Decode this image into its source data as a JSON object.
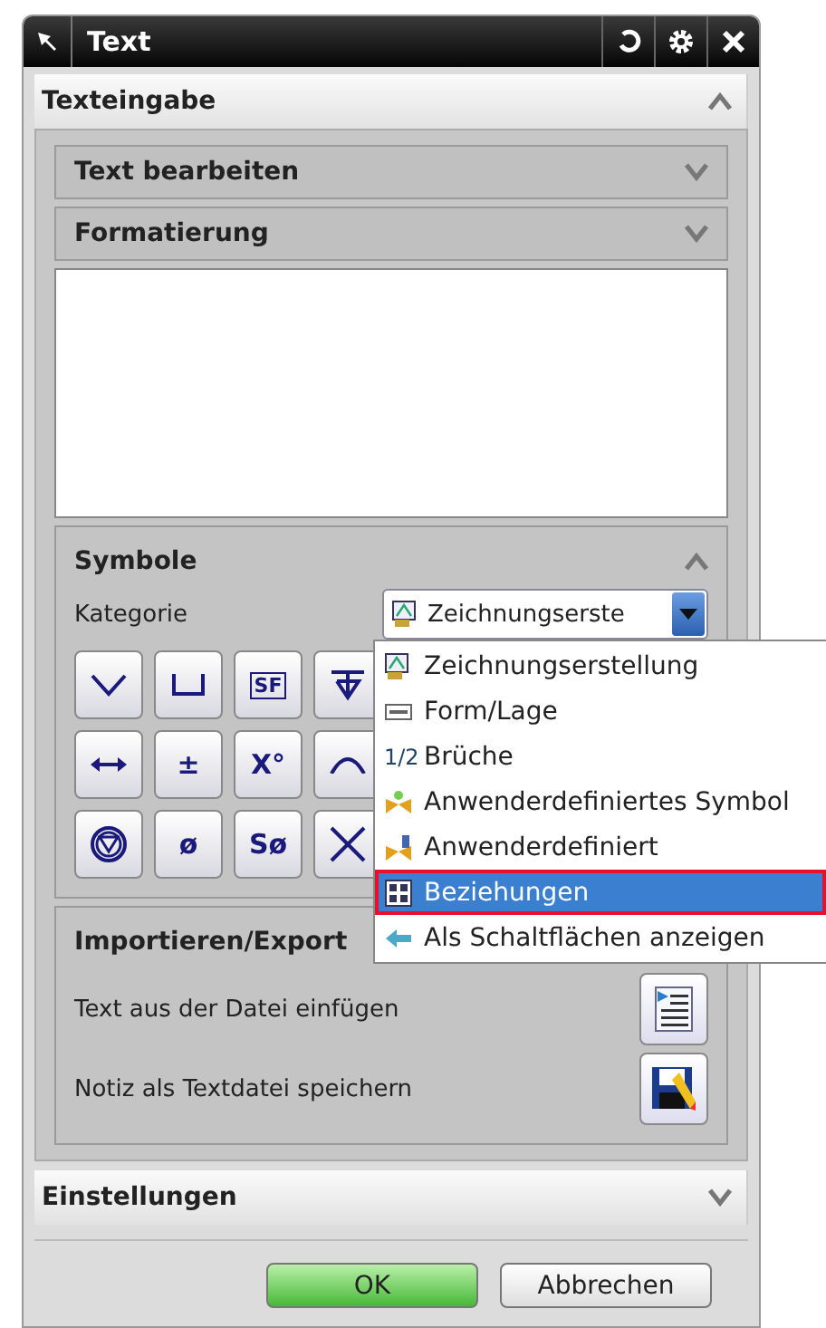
{
  "window": {
    "title": "Text"
  },
  "text_input": {
    "title": "Texteingabe",
    "expanded": true,
    "subsections": [
      {
        "title": "Text bearbeiten",
        "expanded": false
      },
      {
        "title": "Formatierung",
        "expanded": false
      }
    ]
  },
  "symbols": {
    "title": "Symbole",
    "expanded": true,
    "category_label": "Kategorie",
    "category_value": "Zeichnungserste",
    "buttons": [
      {
        "kind": "icon"
      },
      {
        "kind": "icon"
      },
      {
        "kind": "text",
        "label": "SF"
      },
      {
        "kind": "icon"
      },
      {
        "kind": "icon"
      },
      {
        "kind": "text",
        "label": "±"
      },
      {
        "kind": "text",
        "label": "X°"
      },
      {
        "kind": "icon"
      },
      {
        "kind": "icon"
      },
      {
        "kind": "text",
        "label": "ø"
      },
      {
        "kind": "text",
        "label": "Sø"
      },
      {
        "kind": "icon"
      }
    ]
  },
  "category_menu": {
    "items": [
      {
        "label": "Zeichnungserstellung",
        "selected": false
      },
      {
        "label": "Form/Lage",
        "selected": false
      },
      {
        "label": "Brüche",
        "icon_text": "1/2",
        "selected": false
      },
      {
        "label": "Anwenderdefiniertes Symbol",
        "selected": false
      },
      {
        "label": "Anwenderdefiniert",
        "selected": false
      },
      {
        "label": "Beziehungen",
        "selected": true
      },
      {
        "label": "Als Schaltflächen anzeigen",
        "selected": false
      }
    ]
  },
  "import_export": {
    "title": "Importieren/Export",
    "rows": [
      {
        "label": "Text aus der Datei einfügen"
      },
      {
        "label": "Notiz als Textdatei speichern"
      }
    ]
  },
  "settings": {
    "title": "Einstellungen",
    "expanded": false
  },
  "buttons": [
    {
      "label": "OK",
      "kind": "primary"
    },
    {
      "label": "Abbrechen",
      "kind": "secondary"
    }
  ]
}
